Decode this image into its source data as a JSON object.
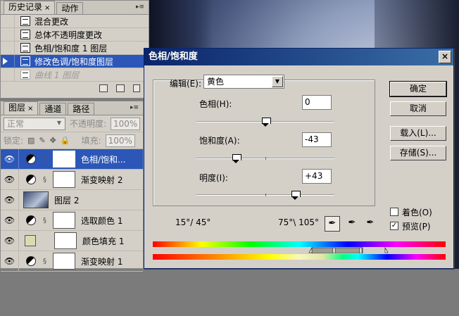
{
  "history_palette": {
    "tabs": [
      {
        "label": "历史记录",
        "close": "×",
        "active": true
      },
      {
        "label": "动作",
        "active": false
      }
    ],
    "items": [
      {
        "label": "混合更改",
        "state": "normal"
      },
      {
        "label": "总体不透明度更改",
        "state": "normal"
      },
      {
        "label": "色相/饱和度 1 图层",
        "state": "normal"
      },
      {
        "label": "修改色调/饱和度图层",
        "state": "selected"
      },
      {
        "label": "曲线 1 图层",
        "state": "disabled"
      }
    ]
  },
  "layers_palette": {
    "tabs": [
      {
        "label": "图层",
        "close": "×",
        "active": true
      },
      {
        "label": "通道",
        "active": false
      },
      {
        "label": "路径",
        "active": false
      }
    ],
    "blend_mode": "正常",
    "opacity_label": "不透明度:",
    "opacity_value": "100%",
    "lock_label": "锁定:",
    "fill_label": "填充:",
    "fill_value": "100%",
    "layers": [
      {
        "name": "色相/饱和...",
        "type": "adjustment",
        "selected": true
      },
      {
        "name": "渐变映射 2",
        "type": "adjustment",
        "selected": false
      },
      {
        "name": "图层 2",
        "type": "photo",
        "selected": false
      },
      {
        "name": "选取颜色 1",
        "type": "adjustment",
        "selected": false
      },
      {
        "name": "颜色填充 1",
        "type": "fill",
        "selected": false,
        "fill_color": "#d9dcaf"
      },
      {
        "name": "渐变映射 1",
        "type": "adjustment",
        "selected": false
      }
    ]
  },
  "dialog": {
    "title": "色相/饱和度",
    "close_glyph": "×",
    "edit_label": "编辑(E):",
    "edit_value": "黄色",
    "hue_label": "色相(H):",
    "hue_value": "0",
    "hue_level": 0,
    "saturation_label": "饱和度(A):",
    "saturation_value": "-43",
    "saturation_level": -43,
    "lightness_label": "明度(I):",
    "lightness_value": "+43",
    "lightness_level": 43,
    "ok_button": "确定",
    "cancel_button": "取消",
    "load_button": "载入(L)...",
    "save_button": "存储(S)...",
    "colorize_label": "着色(O)",
    "colorize_checked": false,
    "preview_label": "预览(P)",
    "preview_checked": true,
    "range_left": "15°/ 45°",
    "range_right": "75°\\ 105°"
  }
}
